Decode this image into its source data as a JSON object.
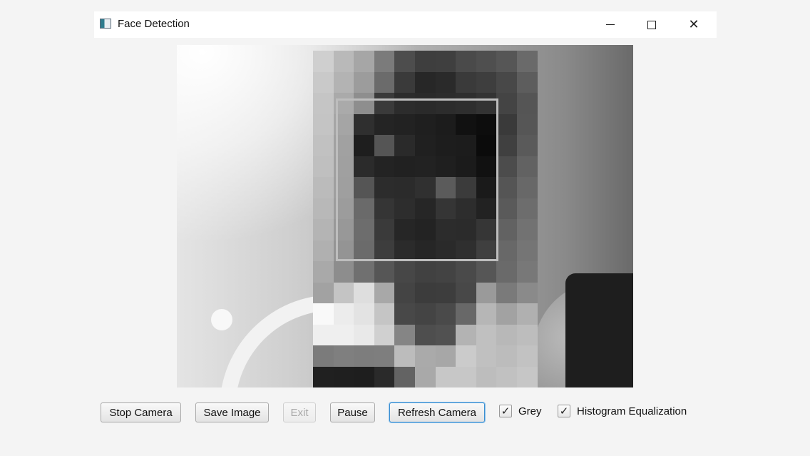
{
  "window": {
    "title": "Face Detection"
  },
  "title_bar": {
    "minimize_icon": "minimize-icon",
    "maximize_icon": "maximize-icon",
    "close_icon": "close-icon",
    "close_glyph": "✕"
  },
  "video": {
    "description_icon": "camera-feed",
    "pixel_grid": [
      [
        "#cfcfcf",
        "#b9b9b9",
        "#a6a6a6",
        "#7b7b7b",
        "#4d4d4d",
        "#3e3e3e",
        "#3f3f3f",
        "#4a4a4a",
        "#4f4f4f",
        "#565656",
        "#6a6a6a"
      ],
      [
        "#c9c9c9",
        "#b3b3b3",
        "#9c9c9c",
        "#6b6b6b",
        "#3a3a3a",
        "#272727",
        "#2a2a2a",
        "#3a3a3a",
        "#3e3e3e",
        "#484848",
        "#5d5d5d"
      ],
      [
        "#c5c5c5",
        "#aaaaaa",
        "#8e8e8e",
        "#3a3a3a",
        "#2c2c2c",
        "#2a2a2a",
        "#2c2c2c",
        "#2e2e2e",
        "#333333",
        "#444444",
        "#555555"
      ],
      [
        "#c4c4c4",
        "#a5a5a5",
        "#2f2f2f",
        "#242424",
        "#222222",
        "#1f1f1f",
        "#1c1c1c",
        "#111111",
        "#0d0d0d",
        "#3a3a3a",
        "#565656"
      ],
      [
        "#c1c1c1",
        "#a1a1a1",
        "#1e1e1e",
        "#555555",
        "#2a2a2a",
        "#202020",
        "#1d1d1d",
        "#1c1c1c",
        "#0b0b0b",
        "#404040",
        "#5a5a5a"
      ],
      [
        "#bfbfbf",
        "#a0a0a0",
        "#2b2b2b",
        "#232323",
        "#212121",
        "#222222",
        "#1f1f1f",
        "#1b1b1b",
        "#111111",
        "#4c4c4c",
        "#626262"
      ],
      [
        "#bbbbbb",
        "#9f9f9f",
        "#555555",
        "#2c2c2c",
        "#2b2b2b",
        "#303030",
        "#5b5b5b",
        "#3b3b3b",
        "#1a1a1a",
        "#555555",
        "#686868"
      ],
      [
        "#b8b8b8",
        "#9c9c9c",
        "#6a6a6a",
        "#353535",
        "#2d2d2d",
        "#262626",
        "#353535",
        "#2d2d2d",
        "#222222",
        "#5a5a5a",
        "#6d6d6d"
      ],
      [
        "#b4b4b4",
        "#989898",
        "#6d6d6d",
        "#3a3a3a",
        "#262626",
        "#232323",
        "#2c2c2c",
        "#2b2b2b",
        "#363636",
        "#626262",
        "#727272"
      ],
      [
        "#b0b0b0",
        "#949494",
        "#6b6b6b",
        "#3d3d3d",
        "#2b2b2b",
        "#262626",
        "#2a2a2a",
        "#2f2f2f",
        "#3f3f3f",
        "#686868",
        "#757575"
      ],
      [
        "#a9a9a9",
        "#8d8d8d",
        "#707070",
        "#565656",
        "#474747",
        "#414141",
        "#434343",
        "#4a4a4a",
        "#565656",
        "#6a6a6a",
        "#787878"
      ],
      [
        "#a2a2a2",
        "#c4c4c4",
        "#dedede",
        "#a8a8a8",
        "#444444",
        "#3c3c3c",
        "#3d3d3d",
        "#484848",
        "#9a9a9a",
        "#7a7a7a",
        "#8a8a8a"
      ],
      [
        "#f9f9f9",
        "#ececec",
        "#e3e3e3",
        "#c5c5c5",
        "#484848",
        "#444444",
        "#4a4a4a",
        "#686868",
        "#b6b6b6",
        "#a2a2a2",
        "#b0b0b0"
      ],
      [
        "#efefef",
        "#efefef",
        "#e9e9e9",
        "#d0d0d0",
        "#858585",
        "#4e4e4e",
        "#515151",
        "#b3b3b3",
        "#c0c0c0",
        "#b8b8b8",
        "#bdbdbd"
      ],
      [
        "#7b7b7b",
        "#7f7f7f",
        "#7d7d7d",
        "#7e7e7e",
        "#bcbcbc",
        "#aaaaaa",
        "#a7a7a7",
        "#cbcbcb",
        "#c0c0c0",
        "#bcbcbc",
        "#c2c2c2"
      ],
      [
        "#202020",
        "#1f1f1f",
        "#1e1e1e",
        "#2a2a2a",
        "#636363",
        "#a9a9a9",
        "#c7c7c7",
        "#c7c7c7",
        "#bdbdbd",
        "#c1c1c1",
        "#c6c6c6"
      ]
    ]
  },
  "controls": {
    "stop_camera": "Stop Camera",
    "save_image": "Save Image",
    "exit": "Exit",
    "pause": "Pause",
    "refresh_camera": "Refresh Camera",
    "grey": {
      "label": "Grey",
      "checked": true
    },
    "histogram": {
      "label": "Histogram Equalization",
      "checked": true
    },
    "check_glyph": "✓"
  }
}
